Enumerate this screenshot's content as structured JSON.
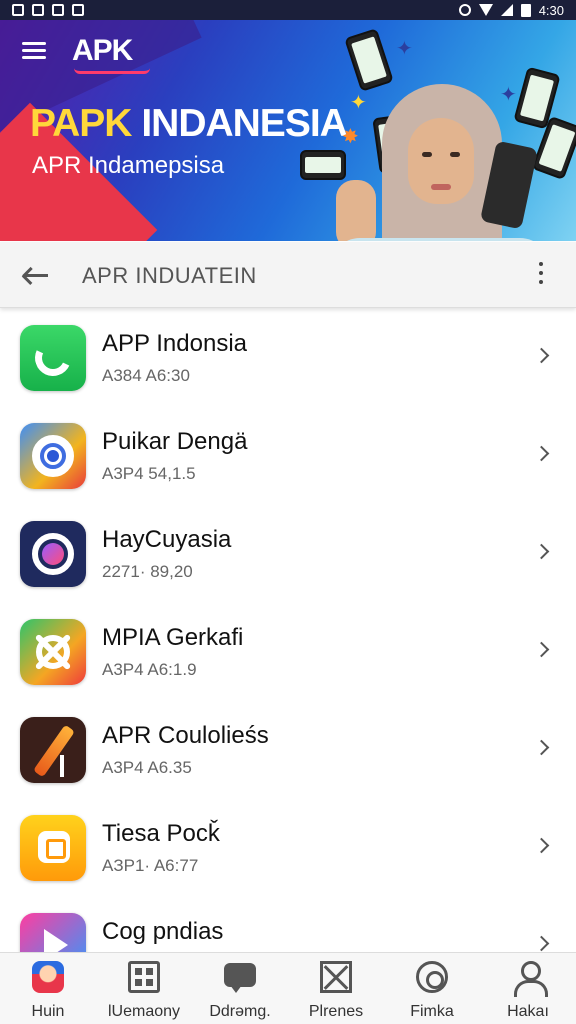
{
  "status_bar": {
    "time": "4:30"
  },
  "banner": {
    "logo": "APK",
    "title_highlight": "PAPK",
    "title_rest": "INDANESIA",
    "subtitle": "APR Indamepsisa"
  },
  "toolbar": {
    "title": "APR INDUATEIN"
  },
  "apps": [
    {
      "name": "APP Indonsia",
      "meta": "A384  A6:30",
      "icon": "phone-icon"
    },
    {
      "name": "Puikar Dengä",
      "meta": "A3P4  54,1.5",
      "icon": "chrome-icon"
    },
    {
      "name": "HayCuyasia",
      "meta": "2271· 89,20",
      "icon": "chat-ring-icon"
    },
    {
      "name": "MPIA Gerkafi",
      "meta": "A3P4  A6:1.9",
      "icon": "cross-ring-icon"
    },
    {
      "name": "APR Coulolieśs",
      "meta": "A3P4  A6.35",
      "icon": "pen-icon"
    },
    {
      "name": "Tiesa Pocǩ",
      "meta": "AЗP1· A6:77",
      "icon": "bubble-icon"
    },
    {
      "name": "Cog pndias",
      "meta": "",
      "icon": "play-icon"
    }
  ],
  "bottom_nav": [
    {
      "label": "Huin",
      "icon": "home-avatar-icon"
    },
    {
      "label": "lUemaony",
      "icon": "grid-icon"
    },
    {
      "label": "Ddrəmg.",
      "icon": "chat-icon"
    },
    {
      "label": "Plrenes",
      "icon": "box-icon"
    },
    {
      "label": "Fimka",
      "icon": "camera-icon"
    },
    {
      "label": "Hakaı",
      "icon": "user-icon"
    }
  ],
  "colors": {
    "accent_yellow": "#ffd83a",
    "banner_blue": "#1f6ad9",
    "banner_red": "#e8364a"
  }
}
